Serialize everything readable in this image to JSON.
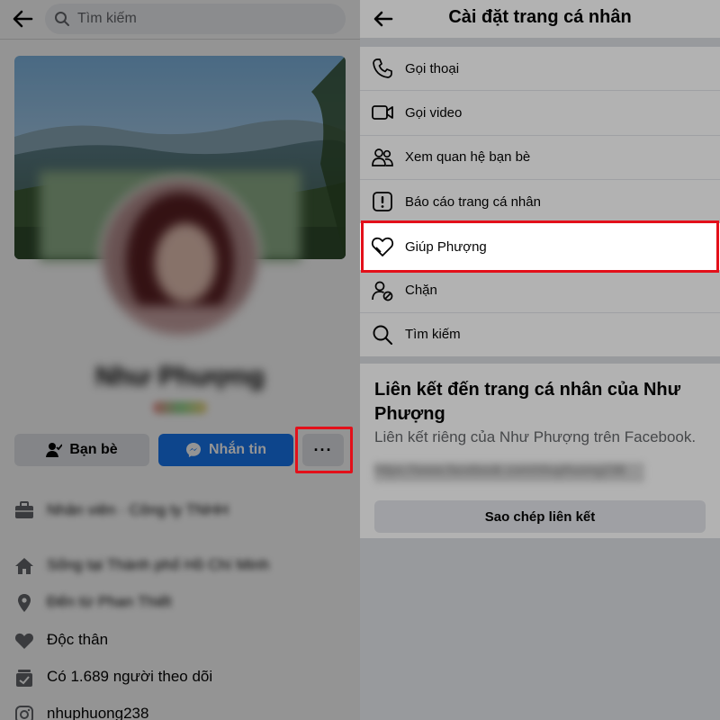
{
  "left": {
    "search_placeholder": "Tìm kiếm",
    "profile_name": "Như Phượng",
    "buttons": {
      "friends": "Bạn bè",
      "message": "Nhắn tin",
      "more": "···"
    },
    "info": [
      {
        "icon": "briefcase-icon",
        "text": "Nhân viên · Công ty TNHH"
      },
      {
        "icon": "home-icon",
        "text": "Sống tại Thành phố Hồ Chí Minh"
      },
      {
        "icon": "location-icon",
        "text": "Đến từ Phan Thiết"
      },
      {
        "icon": "heart-icon",
        "text": "Độc thân"
      },
      {
        "icon": "followers-icon",
        "text": "Có 1.689 người theo dõi"
      },
      {
        "icon": "instagram-icon",
        "text": "nhuphuong238"
      }
    ]
  },
  "right": {
    "title": "Cài đặt trang cá nhân",
    "menu": [
      {
        "icon": "phone-icon",
        "label": "Gọi thoại"
      },
      {
        "icon": "video-icon",
        "label": "Gọi video"
      },
      {
        "icon": "friendship-icon",
        "label": "Xem quan hệ bạn bè"
      },
      {
        "icon": "report-icon",
        "label": "Báo cáo trang cá nhân"
      },
      {
        "icon": "support-heart-icon",
        "label": "Giúp Phượng"
      },
      {
        "icon": "block-user-icon",
        "label": "Chặn"
      },
      {
        "icon": "search-icon",
        "label": "Tìm kiếm"
      }
    ],
    "link_title": "Liên kết đến trang cá nhân của Như Phượng",
    "link_sub": "Liên kết riêng của Như Phượng trên Facebook.",
    "link_url": "https://www.facebook.com/nhuphuong238",
    "copy_button": "Sao chép liên kết"
  },
  "colors": {
    "accent": "#1877f2",
    "highlight_border": "#e3101a"
  }
}
